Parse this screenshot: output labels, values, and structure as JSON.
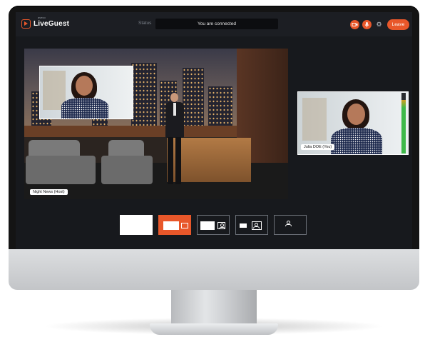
{
  "app": {
    "title": "LiveGuest",
    "subtitle": "aveco"
  },
  "topbar": {
    "status_label": "Status",
    "status_text": "You are connected",
    "buttons": {
      "camera_icon": "camera-icon",
      "mic_icon": "microphone-icon",
      "settings_icon": "gear-icon",
      "leave_label": "Leave"
    }
  },
  "main_video": {
    "label": "Night News (Host)"
  },
  "side_video": {
    "label": "Julia DOE (You)"
  },
  "layouts": [
    {
      "name": "full-frame",
      "selected": false
    },
    {
      "name": "frame-with-inset",
      "selected": true
    },
    {
      "name": "frame-and-person",
      "selected": false
    },
    {
      "name": "small-frame-and-person",
      "selected": false
    },
    {
      "name": "person-only",
      "selected": false
    }
  ],
  "colors": {
    "accent": "#e8572a",
    "background": "#17191d",
    "topbar": "#1c1e23"
  }
}
